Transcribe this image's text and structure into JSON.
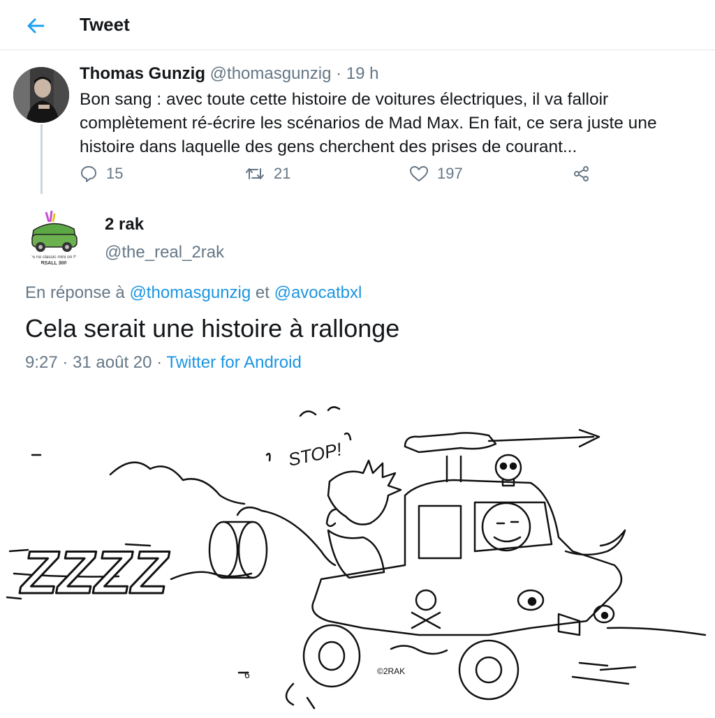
{
  "header": {
    "title": "Tweet",
    "back_icon": "arrow-left-icon",
    "accent": "#1da1f2"
  },
  "parent_tweet": {
    "author_name": "Thomas Gunzig",
    "handle": "@thomasgunzig",
    "separator": " · ",
    "time": "19 h",
    "text": "Bon sang : avec toute cette histoire de voitures électriques, il va falloir complètement ré-écrire les scénarios de Mad Max. En fait, ce sera juste une histoire dans laquelle des gens cherchent des prises de courant...",
    "actions": {
      "reply_count": "15",
      "retweet_count": "21",
      "like_count": "197",
      "share_icon": "share-icon"
    }
  },
  "reply_tweet": {
    "author_name": "2 rak",
    "handle": "@the_real_2rak",
    "reply_prefix": "En réponse à ",
    "reply_mention_1": "@thomasgunzig",
    "reply_and": " et ",
    "reply_mention_2": "@avocatbxl",
    "text": "Cela serait une histoire à rallonge",
    "time": "9:27",
    "separator1": " · ",
    "date": "31 août 20",
    "separator2": " · ",
    "source": "Twitter for Android",
    "avatar_caption_1": "ny no classic mini on th",
    "avatar_caption_2": "RSALL 300"
  },
  "cartoon": {
    "zzz": "ZZZZ",
    "stop": "STOP!",
    "signature": "©2RAK",
    "small_mark": "6"
  }
}
